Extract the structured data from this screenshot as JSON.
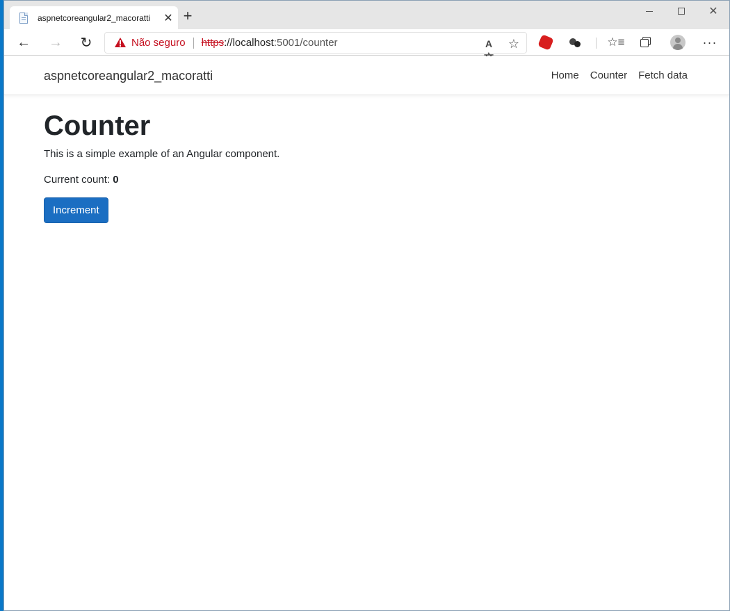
{
  "browser": {
    "tab_title": "aspnetcoreangular2_macoratti",
    "security_label": "Não seguro",
    "url_scheme": "https",
    "url_host": "://localhost",
    "url_rest": ":5001/counter"
  },
  "app": {
    "brand": "aspnetcoreangular2_macoratti",
    "nav": [
      "Home",
      "Counter",
      "Fetch data"
    ]
  },
  "counter": {
    "title": "Counter",
    "description": "This is a simple example of an Angular component.",
    "count_label": "Current count: ",
    "count_value": "0",
    "button_label": "Increment"
  }
}
